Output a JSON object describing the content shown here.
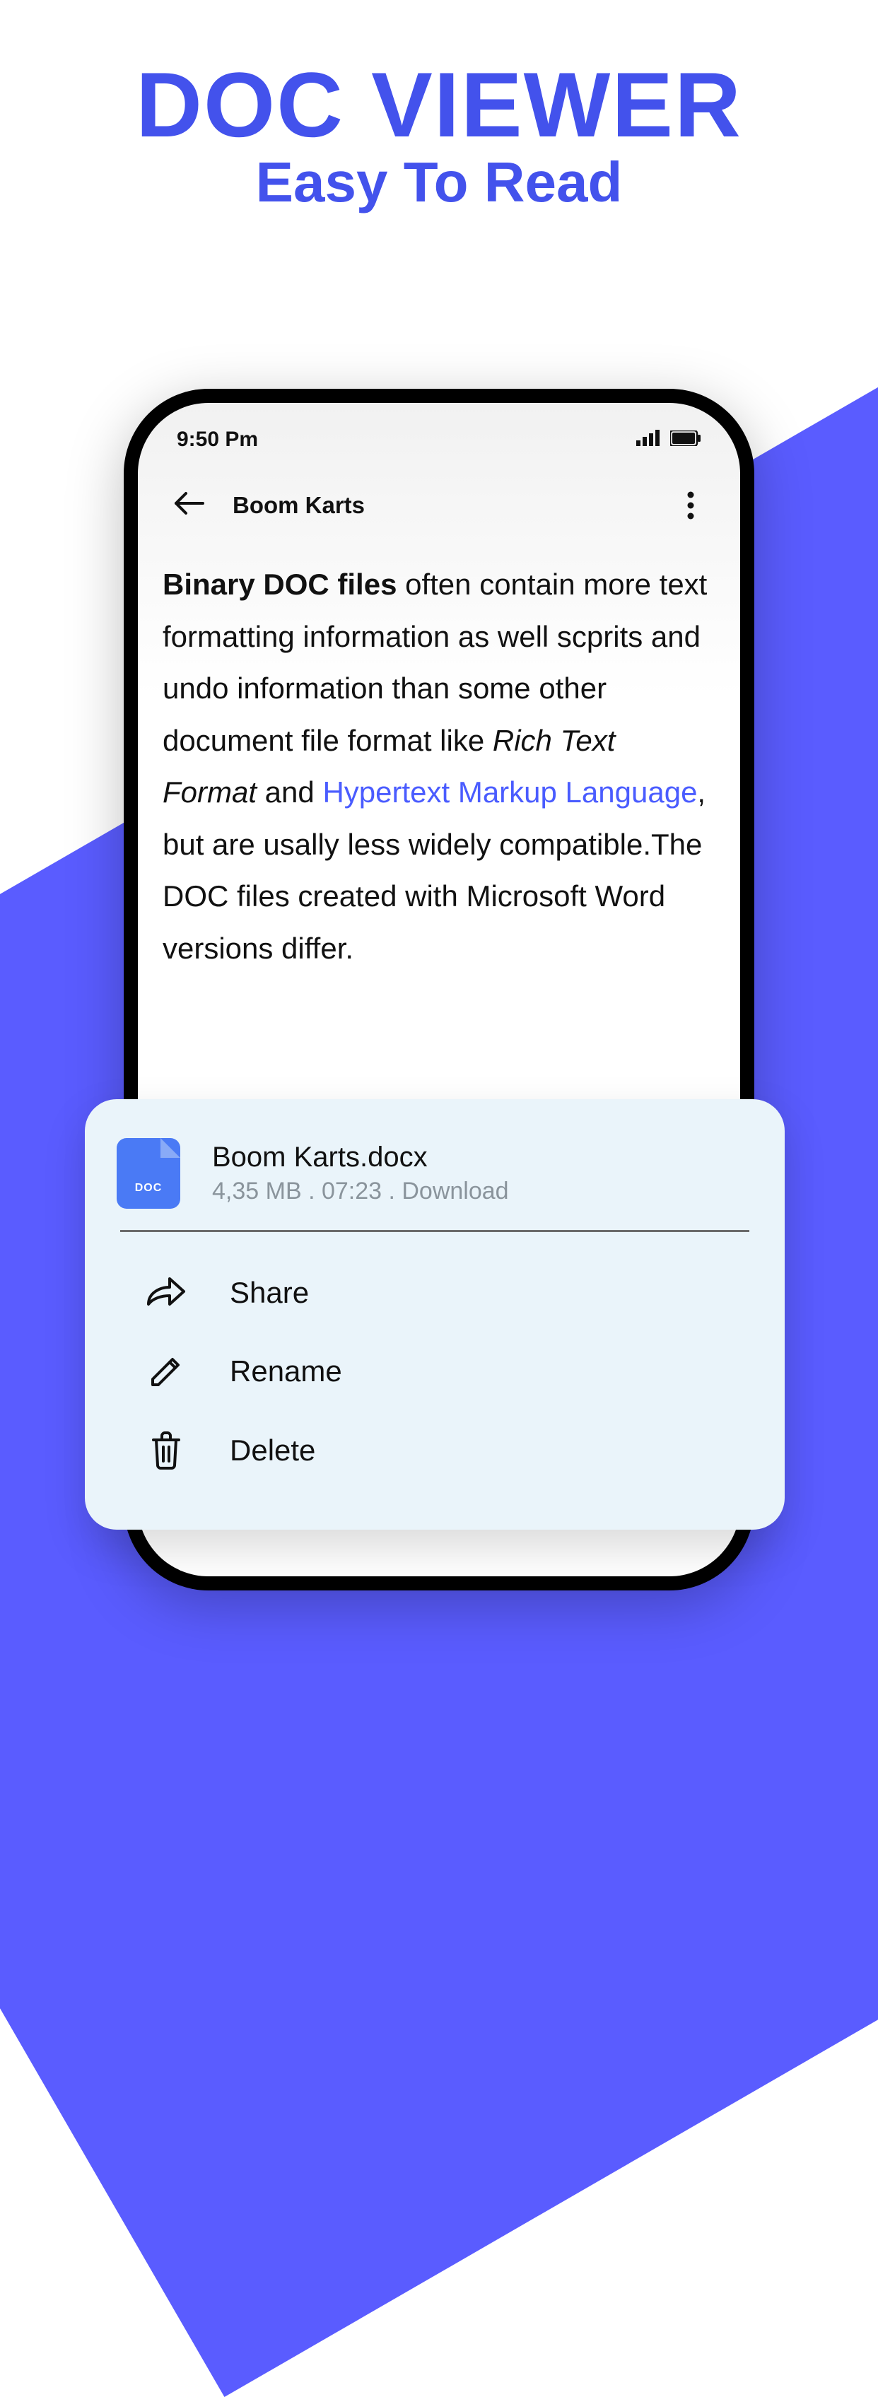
{
  "promo": {
    "line1": "DOC VIEWER",
    "line2": "Easy To Read"
  },
  "status": {
    "time": "9:50 Pm"
  },
  "header": {
    "title": "Boom Karts"
  },
  "doc": {
    "bold_lead": "Binary DOC files",
    "part1": " often contain more text formatting information as well scprits and undo information than some other document file format like ",
    "italic": "Rich Text Format",
    "part2": " and ",
    "link": "Hypertext Markup Language",
    "part3": ", but are usally less widely compatible.The DOC files created with Microsoft Word versions differ."
  },
  "sheet": {
    "file_icon_label": "DOC",
    "filename": "Boom Karts.docx",
    "details": "4,35 MB . 07:23 . Download",
    "actions": {
      "share": "Share",
      "rename": "Rename",
      "delete": "Delete"
    }
  }
}
